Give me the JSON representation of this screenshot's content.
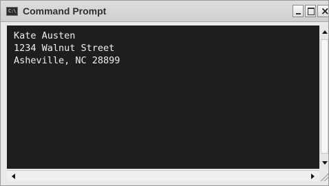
{
  "window": {
    "title": "Command Prompt",
    "icon_glyph": "C:\\"
  },
  "title_controls": {
    "minimize_icon": "minimize-icon",
    "maximize_icon": "maximize-icon",
    "close_label": "×"
  },
  "console": {
    "lines": [
      "Kate Austen",
      "1234 Walnut Street",
      "Asheville, NC 28899"
    ],
    "background": "#1e1e1e",
    "text_color": "#f0f0f0"
  }
}
